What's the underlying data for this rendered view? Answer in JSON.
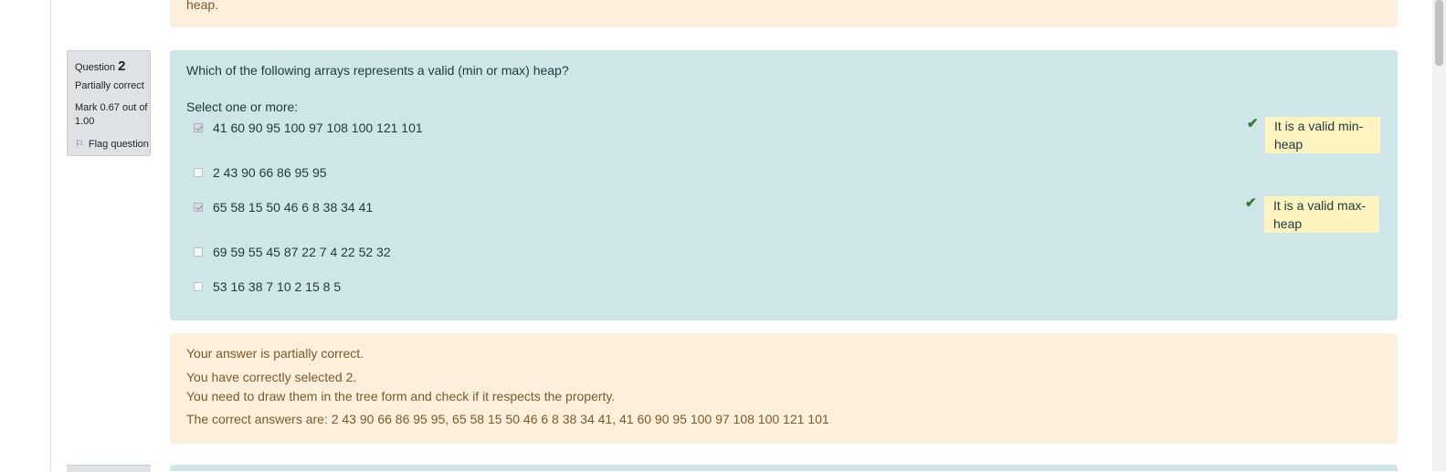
{
  "previous_feedback": {
    "text": "heap."
  },
  "question_info": {
    "question_label": "Question",
    "question_number": "2",
    "state": "Partially correct",
    "grade": "Mark 0.67 out of 1.00",
    "flag_label": "Flag question"
  },
  "formulation": {
    "question_text": "Which of the following arrays represents a valid (min or max) heap?",
    "prompt": "Select one or more:",
    "options": [
      {
        "label": "41 60 90 95 100 97 108 100 121 101",
        "checked": true,
        "correct": true,
        "feedback": "It is a valid min-heap"
      },
      {
        "label": "2 43 90 66 86 95 95",
        "checked": false
      },
      {
        "label": "65 58 15 50 46 6 8 38 34 41",
        "checked": true,
        "correct": true,
        "feedback": "It is a valid max-heap"
      },
      {
        "label": "69 59 55 45 87 22 7 4 22 52 32",
        "checked": false
      },
      {
        "label": "53 16 38 7 10 2 15 8 5",
        "checked": false
      }
    ]
  },
  "outcome": {
    "summary": "Your answer is partially correct.",
    "selected_count": "You have correctly selected 2.",
    "general_feedback": "You need to draw them in the tree form and check if it respects the property.",
    "right_answer": "The correct answers are: 2 43 90 66 86 95 95, 65 58 15 50 46 6 8 38 34 41, 41 60 90 95 100 97 108 100 121 101"
  },
  "colors": {
    "feedback_bg": "#fcefdc",
    "formulation_bg": "#cfe6e9",
    "info_bg": "#dee2e6",
    "correct_tick": "#357a32",
    "specific_feedback_bg": "#fff3bf"
  }
}
